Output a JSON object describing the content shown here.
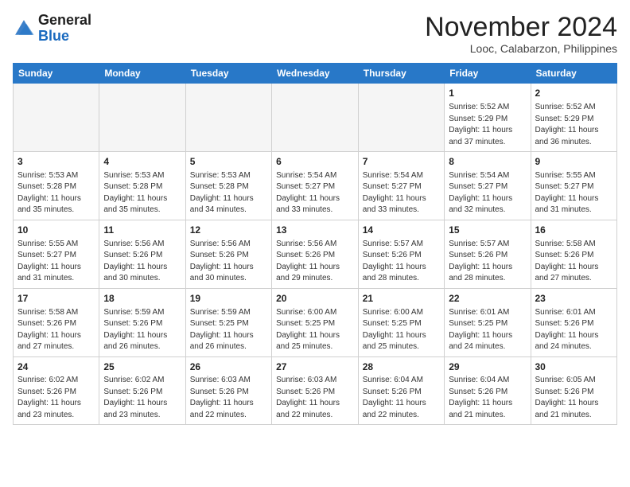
{
  "header": {
    "logo_general": "General",
    "logo_blue": "Blue",
    "month_title": "November 2024",
    "location": "Looc, Calabarzon, Philippines"
  },
  "weekdays": [
    "Sunday",
    "Monday",
    "Tuesday",
    "Wednesday",
    "Thursday",
    "Friday",
    "Saturday"
  ],
  "weeks": [
    [
      {
        "day": "",
        "info": ""
      },
      {
        "day": "",
        "info": ""
      },
      {
        "day": "",
        "info": ""
      },
      {
        "day": "",
        "info": ""
      },
      {
        "day": "",
        "info": ""
      },
      {
        "day": "1",
        "info": "Sunrise: 5:52 AM\nSunset: 5:29 PM\nDaylight: 11 hours\nand 37 minutes."
      },
      {
        "day": "2",
        "info": "Sunrise: 5:52 AM\nSunset: 5:29 PM\nDaylight: 11 hours\nand 36 minutes."
      }
    ],
    [
      {
        "day": "3",
        "info": "Sunrise: 5:53 AM\nSunset: 5:28 PM\nDaylight: 11 hours\nand 35 minutes."
      },
      {
        "day": "4",
        "info": "Sunrise: 5:53 AM\nSunset: 5:28 PM\nDaylight: 11 hours\nand 35 minutes."
      },
      {
        "day": "5",
        "info": "Sunrise: 5:53 AM\nSunset: 5:28 PM\nDaylight: 11 hours\nand 34 minutes."
      },
      {
        "day": "6",
        "info": "Sunrise: 5:54 AM\nSunset: 5:27 PM\nDaylight: 11 hours\nand 33 minutes."
      },
      {
        "day": "7",
        "info": "Sunrise: 5:54 AM\nSunset: 5:27 PM\nDaylight: 11 hours\nand 33 minutes."
      },
      {
        "day": "8",
        "info": "Sunrise: 5:54 AM\nSunset: 5:27 PM\nDaylight: 11 hours\nand 32 minutes."
      },
      {
        "day": "9",
        "info": "Sunrise: 5:55 AM\nSunset: 5:27 PM\nDaylight: 11 hours\nand 31 minutes."
      }
    ],
    [
      {
        "day": "10",
        "info": "Sunrise: 5:55 AM\nSunset: 5:27 PM\nDaylight: 11 hours\nand 31 minutes."
      },
      {
        "day": "11",
        "info": "Sunrise: 5:56 AM\nSunset: 5:26 PM\nDaylight: 11 hours\nand 30 minutes."
      },
      {
        "day": "12",
        "info": "Sunrise: 5:56 AM\nSunset: 5:26 PM\nDaylight: 11 hours\nand 30 minutes."
      },
      {
        "day": "13",
        "info": "Sunrise: 5:56 AM\nSunset: 5:26 PM\nDaylight: 11 hours\nand 29 minutes."
      },
      {
        "day": "14",
        "info": "Sunrise: 5:57 AM\nSunset: 5:26 PM\nDaylight: 11 hours\nand 28 minutes."
      },
      {
        "day": "15",
        "info": "Sunrise: 5:57 AM\nSunset: 5:26 PM\nDaylight: 11 hours\nand 28 minutes."
      },
      {
        "day": "16",
        "info": "Sunrise: 5:58 AM\nSunset: 5:26 PM\nDaylight: 11 hours\nand 27 minutes."
      }
    ],
    [
      {
        "day": "17",
        "info": "Sunrise: 5:58 AM\nSunset: 5:26 PM\nDaylight: 11 hours\nand 27 minutes."
      },
      {
        "day": "18",
        "info": "Sunrise: 5:59 AM\nSunset: 5:26 PM\nDaylight: 11 hours\nand 26 minutes."
      },
      {
        "day": "19",
        "info": "Sunrise: 5:59 AM\nSunset: 5:25 PM\nDaylight: 11 hours\nand 26 minutes."
      },
      {
        "day": "20",
        "info": "Sunrise: 6:00 AM\nSunset: 5:25 PM\nDaylight: 11 hours\nand 25 minutes."
      },
      {
        "day": "21",
        "info": "Sunrise: 6:00 AM\nSunset: 5:25 PM\nDaylight: 11 hours\nand 25 minutes."
      },
      {
        "day": "22",
        "info": "Sunrise: 6:01 AM\nSunset: 5:25 PM\nDaylight: 11 hours\nand 24 minutes."
      },
      {
        "day": "23",
        "info": "Sunrise: 6:01 AM\nSunset: 5:26 PM\nDaylight: 11 hours\nand 24 minutes."
      }
    ],
    [
      {
        "day": "24",
        "info": "Sunrise: 6:02 AM\nSunset: 5:26 PM\nDaylight: 11 hours\nand 23 minutes."
      },
      {
        "day": "25",
        "info": "Sunrise: 6:02 AM\nSunset: 5:26 PM\nDaylight: 11 hours\nand 23 minutes."
      },
      {
        "day": "26",
        "info": "Sunrise: 6:03 AM\nSunset: 5:26 PM\nDaylight: 11 hours\nand 22 minutes."
      },
      {
        "day": "27",
        "info": "Sunrise: 6:03 AM\nSunset: 5:26 PM\nDaylight: 11 hours\nand 22 minutes."
      },
      {
        "day": "28",
        "info": "Sunrise: 6:04 AM\nSunset: 5:26 PM\nDaylight: 11 hours\nand 22 minutes."
      },
      {
        "day": "29",
        "info": "Sunrise: 6:04 AM\nSunset: 5:26 PM\nDaylight: 11 hours\nand 21 minutes."
      },
      {
        "day": "30",
        "info": "Sunrise: 6:05 AM\nSunset: 5:26 PM\nDaylight: 11 hours\nand 21 minutes."
      }
    ]
  ]
}
